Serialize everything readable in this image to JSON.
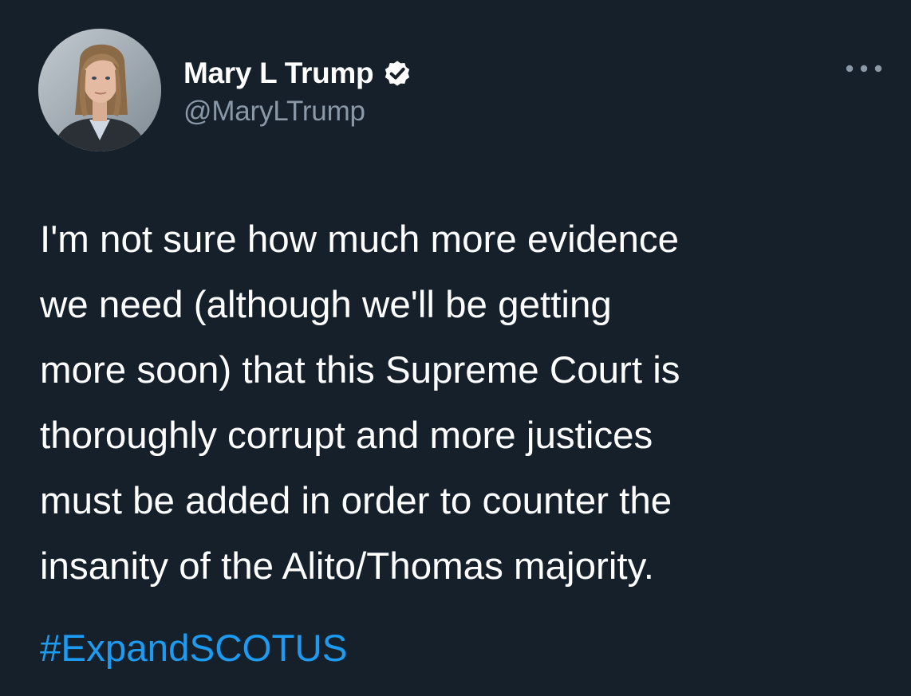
{
  "author": {
    "display_name": "Mary L Trump",
    "handle": "@MaryLTrump",
    "verified": true,
    "avatar_icon": "profile-photo"
  },
  "menu": {
    "icon": "more-options-icon"
  },
  "tweet": {
    "text_lines": [
      "I'm not sure how much more evidence",
      "we need (although we'll be getting",
      "more soon) that this Supreme Court is",
      "thoroughly corrupt and more justices",
      "must be added in order to counter the",
      "insanity of the Alito/Thomas majority."
    ],
    "hashtag": "#ExpandSCOTUS"
  },
  "colors": {
    "background": "#15202b",
    "text": "#ffffff",
    "secondary_text": "#8b98a5",
    "link": "#1d9bf0"
  }
}
